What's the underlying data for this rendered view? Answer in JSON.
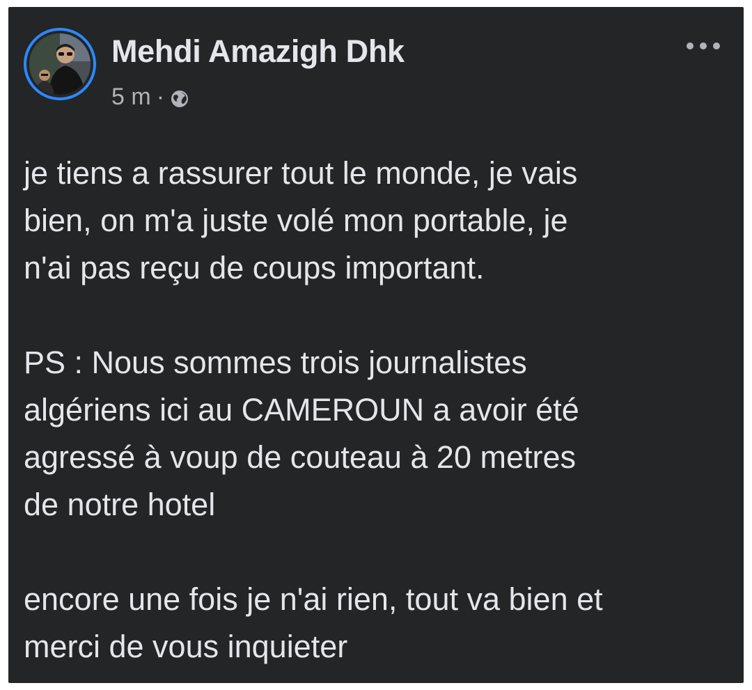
{
  "post": {
    "author_name": "Mehdi Amazigh Dhk",
    "timestamp": "5 m",
    "separator": "·",
    "privacy_icon": "globe-icon",
    "more_icon": "more-options-icon",
    "paragraphs": [
      "je tiens a rassurer tout le monde, je vais\nbien, on m'a juste volé mon portable, je\nn'ai pas reçu de coups important.",
      "PS : Nous sommes trois journalistes\nalgériens ici au CAMEROUN a avoir été\nagressé à voup de couteau à 20 metres\nde notre hotel",
      "encore une fois je n'ai rien, tout va bien et\nmerci de vous inquieter"
    ]
  },
  "colors": {
    "card_background": "#242526",
    "text_primary": "#e4e6eb",
    "text_secondary": "#b0b3b8",
    "avatar_ring": "#2d88ff"
  }
}
